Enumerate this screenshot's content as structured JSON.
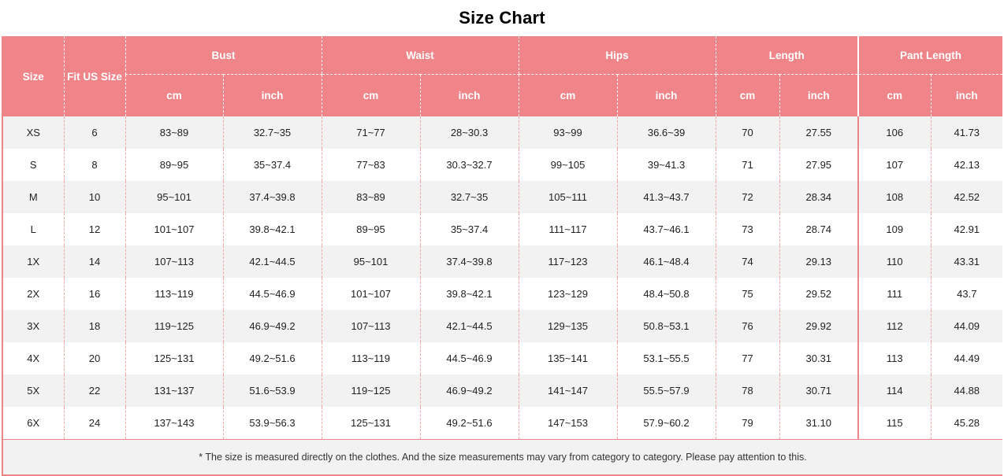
{
  "title": "Size Chart",
  "table": {
    "groups": [
      {
        "label": "Size",
        "span": 1,
        "rowspan": 2
      },
      {
        "label": "Fit US Size",
        "span": 1,
        "rowspan": 2
      },
      {
        "label": "Bust",
        "span": 2
      },
      {
        "label": "Waist",
        "span": 2
      },
      {
        "label": "Hips",
        "span": 2
      },
      {
        "label": "Length",
        "span": 2
      },
      {
        "label": "Pant Length",
        "span": 2
      }
    ],
    "units": [
      "cm",
      "inch",
      "cm",
      "inch",
      "cm",
      "inch",
      "cm",
      "inch",
      "cm",
      "inch"
    ],
    "columns": [
      "Size",
      "Fit US Size",
      "Bust cm",
      "Bust inch",
      "Waist cm",
      "Waist inch",
      "Hips cm",
      "Hips inch",
      "Length cm",
      "Length inch",
      "Pant Length cm",
      "Pant Length inch"
    ],
    "rows": [
      {
        "size": "XS",
        "fit_us": "6",
        "bust_cm": "83~89",
        "bust_in": "32.7~35",
        "waist_cm": "71~77",
        "waist_in": "28~30.3",
        "hips_cm": "93~99",
        "hips_in": "36.6~39",
        "length_cm": "70",
        "length_in": "27.55",
        "pant_cm": "106",
        "pant_in": "41.73"
      },
      {
        "size": "S",
        "fit_us": "8",
        "bust_cm": "89~95",
        "bust_in": "35~37.4",
        "waist_cm": "77~83",
        "waist_in": "30.3~32.7",
        "hips_cm": "99~105",
        "hips_in": "39~41.3",
        "length_cm": "71",
        "length_in": "27.95",
        "pant_cm": "107",
        "pant_in": "42.13"
      },
      {
        "size": "M",
        "fit_us": "10",
        "bust_cm": "95~101",
        "bust_in": "37.4~39.8",
        "waist_cm": "83~89",
        "waist_in": "32.7~35",
        "hips_cm": "105~111",
        "hips_in": "41.3~43.7",
        "length_cm": "72",
        "length_in": "28.34",
        "pant_cm": "108",
        "pant_in": "42.52"
      },
      {
        "size": "L",
        "fit_us": "12",
        "bust_cm": "101~107",
        "bust_in": "39.8~42.1",
        "waist_cm": "89~95",
        "waist_in": "35~37.4",
        "hips_cm": "111~117",
        "hips_in": "43.7~46.1",
        "length_cm": "73",
        "length_in": "28.74",
        "pant_cm": "109",
        "pant_in": "42.91"
      },
      {
        "size": "1X",
        "fit_us": "14",
        "bust_cm": "107~113",
        "bust_in": "42.1~44.5",
        "waist_cm": "95~101",
        "waist_in": "37.4~39.8",
        "hips_cm": "117~123",
        "hips_in": "46.1~48.4",
        "length_cm": "74",
        "length_in": "29.13",
        "pant_cm": "110",
        "pant_in": "43.31"
      },
      {
        "size": "2X",
        "fit_us": "16",
        "bust_cm": "113~119",
        "bust_in": "44.5~46.9",
        "waist_cm": "101~107",
        "waist_in": "39.8~42.1",
        "hips_cm": "123~129",
        "hips_in": "48.4~50.8",
        "length_cm": "75",
        "length_in": "29.52",
        "pant_cm": "111",
        "pant_in": "43.7"
      },
      {
        "size": "3X",
        "fit_us": "18",
        "bust_cm": "119~125",
        "bust_in": "46.9~49.2",
        "waist_cm": "107~113",
        "waist_in": "42.1~44.5",
        "hips_cm": "129~135",
        "hips_in": "50.8~53.1",
        "length_cm": "76",
        "length_in": "29.92",
        "pant_cm": "112",
        "pant_in": "44.09"
      },
      {
        "size": "4X",
        "fit_us": "20",
        "bust_cm": "125~131",
        "bust_in": "49.2~51.6",
        "waist_cm": "113~119",
        "waist_in": "44.5~46.9",
        "hips_cm": "135~141",
        "hips_in": "53.1~55.5",
        "length_cm": "77",
        "length_in": "30.31",
        "pant_cm": "113",
        "pant_in": "44.49"
      },
      {
        "size": "5X",
        "fit_us": "22",
        "bust_cm": "131~137",
        "bust_in": "51.6~53.9",
        "waist_cm": "119~125",
        "waist_in": "46.9~49.2",
        "hips_cm": "141~147",
        "hips_in": "55.5~57.9",
        "length_cm": "78",
        "length_in": "30.71",
        "pant_cm": "114",
        "pant_in": "44.88"
      },
      {
        "size": "6X",
        "fit_us": "24",
        "bust_cm": "137~143",
        "bust_in": "53.9~56.3",
        "waist_cm": "125~131",
        "waist_in": "49.2~51.6",
        "hips_cm": "147~153",
        "hips_in": "57.9~60.2",
        "length_cm": "79",
        "length_in": "31.10",
        "pant_cm": "115",
        "pant_in": "45.28"
      }
    ],
    "note": "* The size is measured directly on the clothes. And the size measurements may vary from category to category. Please pay attention to this."
  },
  "colors": {
    "header_pink": "#ef8489",
    "border_pink": "#ef8489",
    "row_alt": "#f2f2f2",
    "row_base": "#ffffff",
    "text": "#222222"
  }
}
